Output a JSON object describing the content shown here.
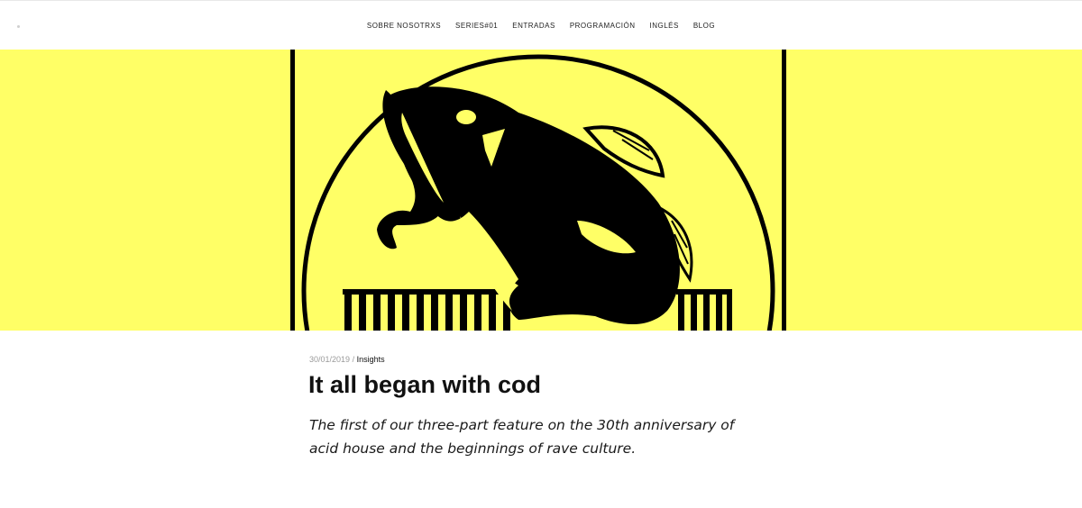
{
  "header": {
    "nav_items": [
      {
        "label": "SOBRE NOSOTRXS"
      },
      {
        "label": "SERIES#01"
      },
      {
        "label": "ENTRADAS"
      },
      {
        "label": "PROGRAMACIÓN"
      },
      {
        "label": "INGLÉS"
      },
      {
        "label": "BLOG"
      }
    ]
  },
  "hero": {
    "background_color": "#ffff66",
    "image_icon": "fish-logo-icon"
  },
  "post": {
    "date": "30/01/2019",
    "separator": "/",
    "category": "Insights",
    "title": "It all began with cod",
    "excerpt": "The first of our three-part feature on the 30th anniversary of acid house and the beginnings of rave culture."
  }
}
